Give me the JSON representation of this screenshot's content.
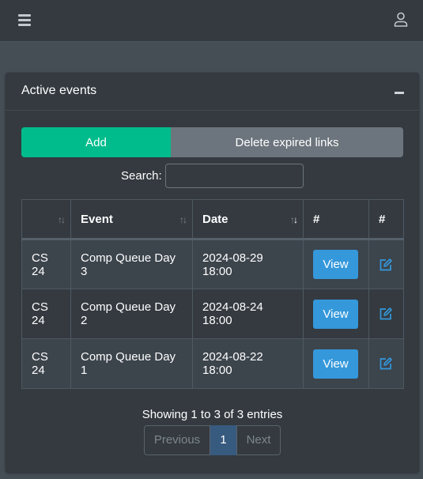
{
  "card": {
    "title": "Active events"
  },
  "actions": {
    "add_label": "Add",
    "delete_label": "Delete expired links"
  },
  "search": {
    "label": "Search:",
    "value": "",
    "placeholder": ""
  },
  "table": {
    "columns": [
      "",
      "Event",
      "Date",
      "#",
      "#"
    ],
    "rows": [
      {
        "code": "CS 24",
        "event": "Comp Queue Day 3",
        "date": "2024-08-29 18:00",
        "view": "View"
      },
      {
        "code": "CS 24",
        "event": "Comp Queue Day 2",
        "date": "2024-08-24 18:00",
        "view": "View"
      },
      {
        "code": "CS 24",
        "event": "Comp Queue Day 1",
        "date": "2024-08-22 18:00",
        "view": "View"
      }
    ]
  },
  "pagination": {
    "info": "Showing 1 to 3 of 3 entries",
    "previous": "Previous",
    "current": "1",
    "next": "Next"
  },
  "icons": {
    "menu": "hamburger-icon",
    "user": "user-icon",
    "collapse": "minus-icon",
    "edit": "edit-icon",
    "sort": "sort-icon"
  },
  "colors": {
    "add": "#00bc8c",
    "delete": "#6c757d",
    "view": "#3498db",
    "active_page": "#375a7f"
  }
}
